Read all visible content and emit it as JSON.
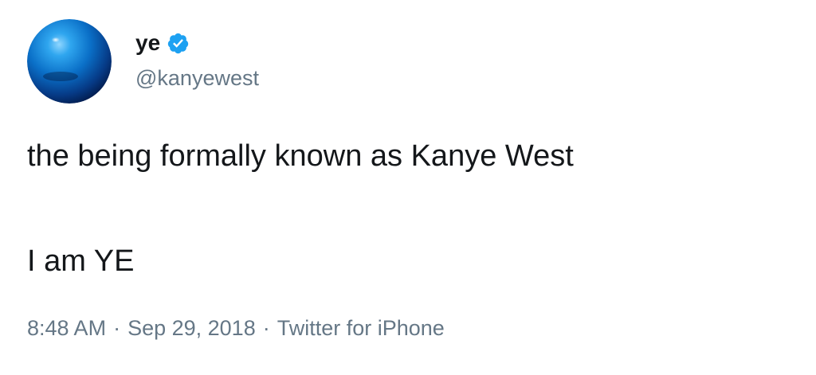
{
  "author": {
    "display_name": "ye",
    "handle": "@kanyewest",
    "avatar_icon": "blue-sphere-avatar",
    "verified_icon": "verified-badge-icon",
    "verified_color": "#1da1f2"
  },
  "tweet": {
    "line1": "the being formally known as Kanye West",
    "line2": "I am YE"
  },
  "meta": {
    "time": "8:48 AM",
    "separator": "·",
    "date": "Sep 29, 2018",
    "source": "Twitter for iPhone"
  },
  "colors": {
    "text_primary": "#14171a",
    "text_secondary": "#657786",
    "background": "#ffffff"
  }
}
